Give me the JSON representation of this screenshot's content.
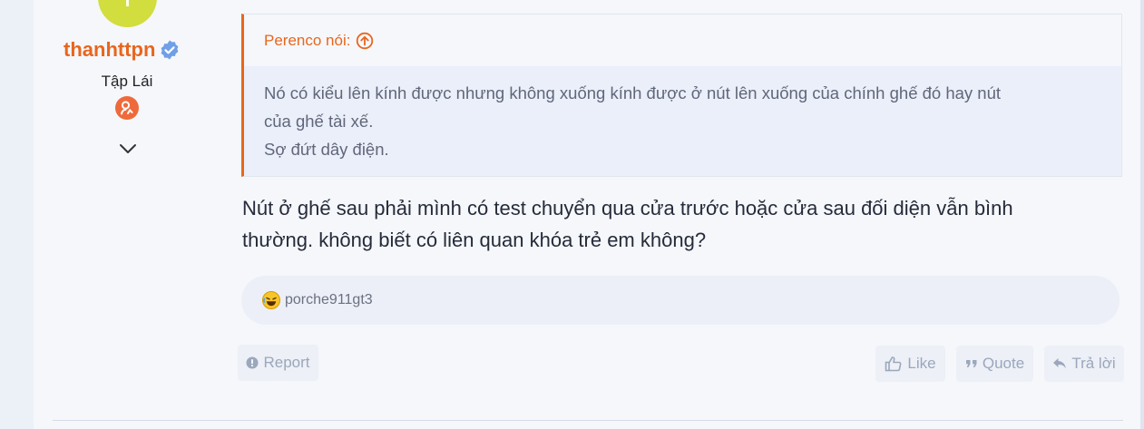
{
  "user": {
    "avatar_letter": "T",
    "avatar_color": "#d2dd3e",
    "name": "thanhttpn",
    "name_color": "#e8661d",
    "verified_icon": "verified-badge-icon",
    "title": "Tập Lái",
    "badge_icon": "trophy-badge-icon",
    "expand_icon": "chevron-down-icon"
  },
  "quote": {
    "author_line": "Perenco nói:",
    "jump_icon": "arrow-up-circle-icon",
    "lines": [
      "Nó có kiểu lên kính được nhưng không xuống kính được ở nút lên xuống của chính ghế đó hay nút",
      "của ghế tài xế.",
      "Sợ đứt dây điện."
    ]
  },
  "message": {
    "lines": [
      "Nút ở ghế sau phải mình có test chuyển qua cửa trước hoặc cửa sau đối diện vẫn bình",
      "thường. không biết có liên quan khóa trẻ em không?"
    ]
  },
  "reactions": {
    "icon": "laughing-emoji-icon",
    "users": "porche911gt3"
  },
  "actions": {
    "report": "Report",
    "like": "Like",
    "quote": "Quote",
    "reply": "Trả lời"
  }
}
